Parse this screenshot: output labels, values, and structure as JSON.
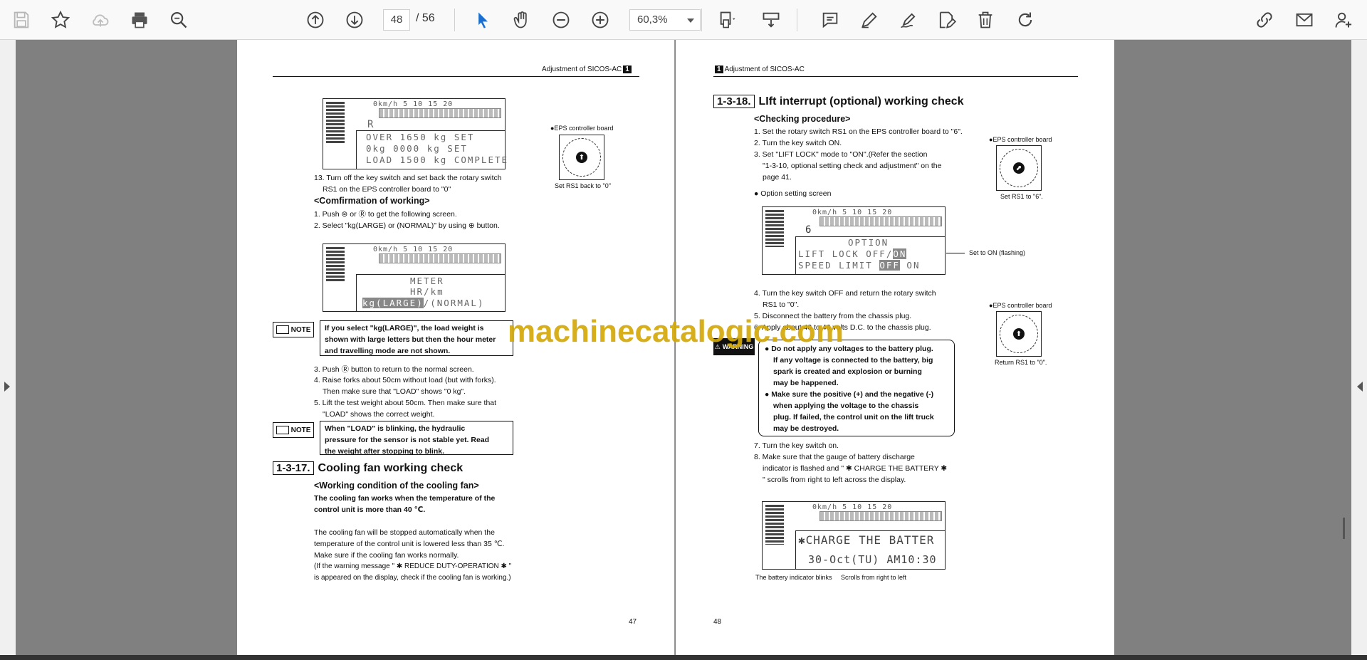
{
  "toolbar": {
    "page_current": "48",
    "page_total": "/ 56",
    "zoom": "60,3%"
  },
  "left_page": {
    "header": "Adjustment of SICOS-AC",
    "header_num": "1",
    "lcd1": {
      "scale": "0km/h 5   10   15   20",
      "mode": "R",
      "line1": "OVER 1650 kg SET",
      "line2": " 0kg 0000 kg SET",
      "line3": "LOAD 1500 kg COMPLETE"
    },
    "eps_label_1": "●EPS controller board",
    "rotary_caption_1": "Set RS1 back to \"0\"",
    "step13_a": "13. Turn off the key switch and set back the rotary switch",
    "step13_b": "RS1 on the EPS controller board to \"0\"",
    "confirm_heading": "<Comfirmation of working>",
    "confirm_1": "1. Push ⊜ or Ⓡ to get the following screen.",
    "confirm_2": "2. Select \"kg(LARGE) or (NORMAL)\" by using ⊕ button.",
    "lcd2": {
      "scale": "0km/h 5   10   15   20",
      "line1": "METER",
      "line2": "HR/km",
      "line3a": "kg(LARGE)",
      "line3b": "/(NORMAL)"
    },
    "note_label": "NOTE",
    "note1_a": "If you select \"kg(LARGE)\", the load weight is",
    "note1_b": "shown with large letters but then the hour meter",
    "note1_c": "and travelling mode are not shown.",
    "step3": "3. Push Ⓡ button to return to the normal screen.",
    "step4_a": "4. Raise forks about 50cm without load (but with forks).",
    "step4_b": "Then make sure that \"LOAD\" shows \"0 kg\".",
    "step5_a": "5. Lift the test weight about 50cm. Then make sure that",
    "step5_b": "\"LOAD\" shows the correct weight.",
    "note2_a": "When \"LOAD\" is blinking, the hydraulic",
    "note2_b": "pressure for the sensor is not stable yet. Read",
    "note2_c": "the weight after stopping to blink.",
    "sec_num": "1-3-17.",
    "sec_title": "Cooling fan working check",
    "work_heading": "<Working condition of the cooling fan>",
    "fan_bold_a": "The cooling fan works when the temperature of the",
    "fan_bold_b": "control unit is more than 40 ℃.",
    "fan_1": "The cooling fan will be stopped automatically when the",
    "fan_2": "temperature of the control unit is lowered less than 35 ℃.",
    "fan_3": "Make sure if the cooling fan works normally.",
    "fan_4": "(If the warning message \" ✱ REDUCE DUTY-OPERATION ✱ \"",
    "fan_5": "is appeared on the display, check if the cooling fan is working.)",
    "page_number": "47"
  },
  "right_page": {
    "header_num": "1",
    "header": "Adjustment of SICOS-AC",
    "sec_num": "1-3-18.",
    "sec_title": "LIft interrupt (optional) working check",
    "proc_heading": "<Checking procedure>",
    "s1": "1. Set the rotary switch RS1 on the EPS controller board to \"6\".",
    "s2": "2. Turn the key switch ON.",
    "s3_a": "3. Set \"LIFT LOCK\" mode to \"ON\".(Refer the section",
    "s3_b": "\"1-3-10, optional setting check and adjustment\" on the",
    "s3_c": "page 41.",
    "option_label": "● Option setting screen",
    "eps_label_2": "●EPS controller board",
    "rotary_caption_2": "Set RS1 to \"6\".",
    "lcd3": {
      "scale": "0km/h 5   10   15   20",
      "mode": "6",
      "line1": "OPTION",
      "line2a": "LIFT LOCK  OFF/",
      "line2b": "ON",
      "line3a": "SPEED LIMIT ",
      "line3b": "OFF",
      "line3c": " ON"
    },
    "set_on_caption": "Set to ON (flashing)",
    "s4_a": "4. Turn the key switch OFF and return the rotary switch",
    "s4_b": "RS1 to \"0\".",
    "s5": "5. Disconnect the battery from the chassis plug.",
    "s6": "6. Apply about 40 to 46 volts D.C. to the chassis plug.",
    "eps_label_3": "●EPS controller board",
    "rotary_caption_3": "Return RS1 to \"0\".",
    "warning_label": "WARNING",
    "warn1": "● Do not apply any voltages to the battery plug.",
    "warn2": "If any voltage is connected to the battery, big",
    "warn3": "spark is created and explosion or burning",
    "warn4": "may be happened.",
    "warn5": "● Make sure the positive (+) and the negative  (-)",
    "warn6": "when applying the voltage to the chassis",
    "warn7": "plug. If failed, the control unit on the lift truck",
    "warn8": "may be destroyed.",
    "s7": "7. Turn the key switch on.",
    "s8_a": "8. Make sure that the gauge of battery discharge",
    "s8_b": "indicator is flashed and \" ✱ CHARGE THE BATTERY ✱",
    "s8_c": "\"    scrolls from right to left across the display.",
    "lcd4": {
      "scale": "0km/h 5   10   15   20",
      "line1": "✱CHARGE THE BATTER",
      "line2": "30-Oct(TU)  AM10:30"
    },
    "cap_blink": "The battery indicator blinks",
    "cap_scroll": "Scrolls from right to left",
    "page_number": "48"
  },
  "watermark": "machinecatalogic.com"
}
